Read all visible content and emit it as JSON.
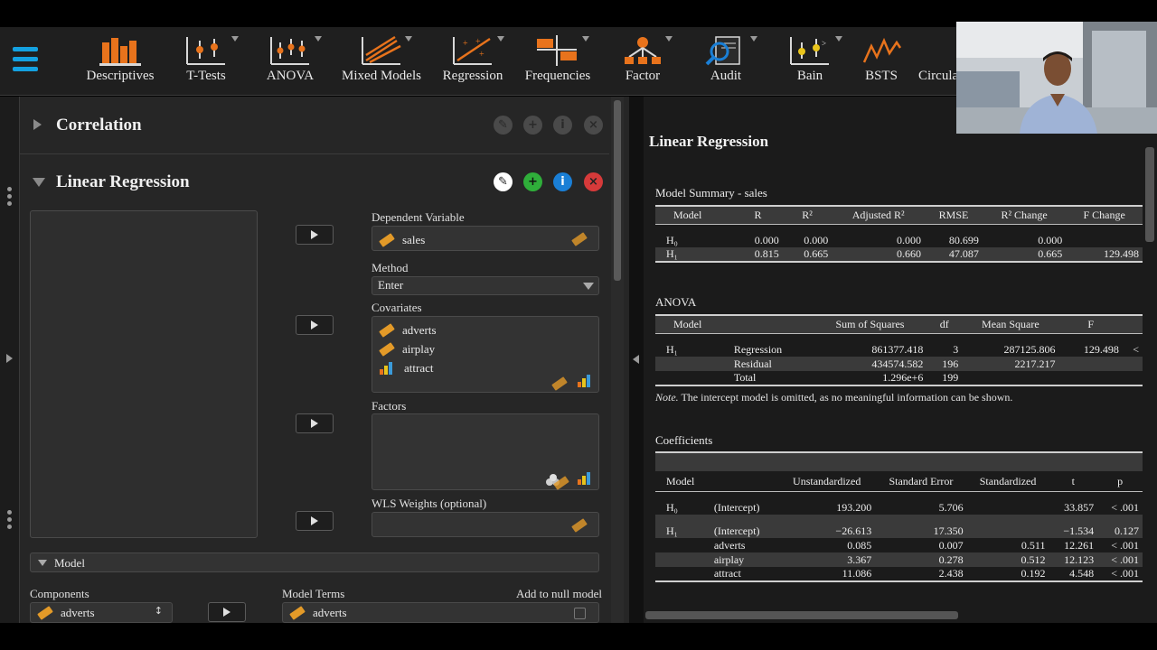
{
  "toolbar": {
    "items": [
      {
        "label": "Descriptives"
      },
      {
        "label": "T-Tests"
      },
      {
        "label": "ANOVA"
      },
      {
        "label": "Mixed Models"
      },
      {
        "label": "Regression"
      },
      {
        "label": "Frequencies"
      },
      {
        "label": "Factor"
      },
      {
        "label": "Audit"
      },
      {
        "label": "Bain"
      },
      {
        "label": "BSTS"
      },
      {
        "label": "Circula"
      }
    ]
  },
  "left": {
    "correlation_title": "Correlation",
    "lr_title": "Linear Regression",
    "dependent_label": "Dependent Variable",
    "dependent_value": "sales",
    "method_label": "Method",
    "method_value": "Enter",
    "covariates_label": "Covariates",
    "covariates": [
      "adverts",
      "airplay",
      "attract"
    ],
    "factors_label": "Factors",
    "wls_label": "WLS Weights (optional)",
    "model_section": "Model",
    "components_label": "Components",
    "components_first": "adverts",
    "model_terms_label": "Model Terms",
    "add_null_label": "Add to null model",
    "model_terms_first": "adverts"
  },
  "right": {
    "title": "Linear Regression",
    "model_summary": {
      "caption": "Model Summary - sales",
      "headers": [
        "Model",
        "R",
        "R²",
        "Adjusted R²",
        "RMSE",
        "R² Change",
        "F Change"
      ],
      "rows": [
        [
          "H₀",
          "0.000",
          "0.000",
          "0.000",
          "80.699",
          "0.000",
          ""
        ],
        [
          "H₁",
          "0.815",
          "0.665",
          "0.660",
          "47.087",
          "0.665",
          "129.498"
        ]
      ]
    },
    "anova": {
      "caption": "ANOVA",
      "headers": [
        "Model",
        "",
        "Sum of Squares",
        "df",
        "Mean Square",
        "F",
        ""
      ],
      "rows": [
        [
          "H₁",
          "Regression",
          "861377.418",
          "3",
          "287125.806",
          "129.498",
          "<"
        ],
        [
          "",
          "Residual",
          "434574.582",
          "196",
          "2217.217",
          "",
          ""
        ],
        [
          "",
          "Total",
          "1.296e+6",
          "199",
          "",
          "",
          ""
        ]
      ],
      "note_label": "Note.",
      "note_text": " The intercept model is omitted, as no meaningful information can be shown."
    },
    "coefficients": {
      "caption": "Coefficients",
      "headers": [
        "Model",
        "",
        "Unstandardized",
        "Standard Error",
        "Standardized",
        "t",
        "p"
      ],
      "rows": [
        [
          "H₀",
          "(Intercept)",
          "193.200",
          "5.706",
          "",
          "33.857",
          "< .001"
        ],
        [
          "H₁",
          "(Intercept)",
          "−26.613",
          "17.350",
          "",
          "−1.534",
          "0.127"
        ],
        [
          "",
          "adverts",
          "0.085",
          "0.007",
          "0.511",
          "12.261",
          "< .001"
        ],
        [
          "",
          "airplay",
          "3.367",
          "0.278",
          "0.512",
          "12.123",
          "< .001"
        ],
        [
          "",
          "attract",
          "11.086",
          "2.438",
          "0.192",
          "4.548",
          "< .001"
        ]
      ]
    }
  },
  "colors": {
    "accent": "#14a1e0",
    "icon_orange": "#e8731c",
    "edit_white": "#ffffff",
    "add_green": "#2fae3a",
    "info_blue": "#1a7fd6",
    "remove_red": "#d63a3a"
  }
}
